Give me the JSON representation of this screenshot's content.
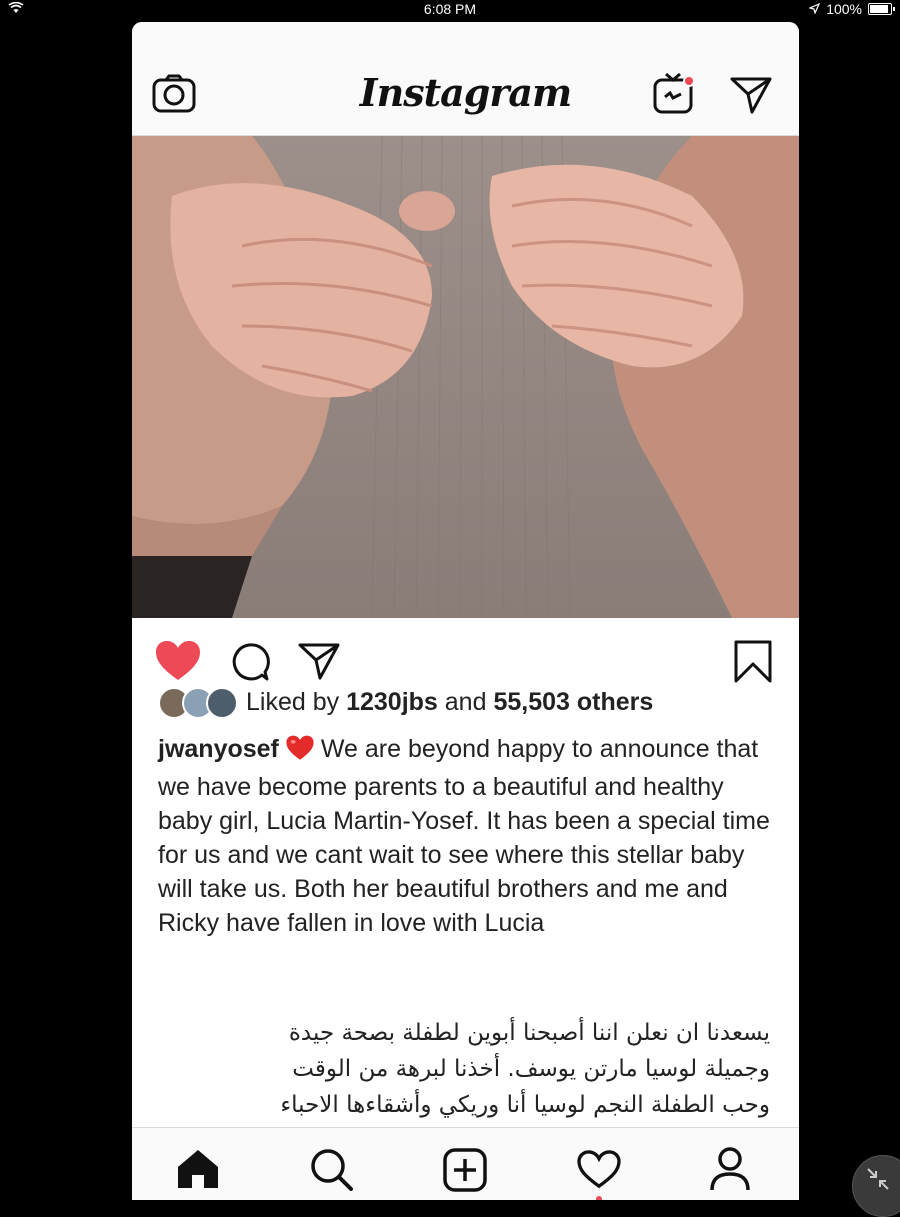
{
  "status_bar": {
    "time": "6:08 PM",
    "battery": "100%",
    "battery_level": 1.0
  },
  "app": {
    "title": "Instagram"
  },
  "top_icons": {
    "camera": "camera-icon",
    "igtv": "igtv-icon",
    "direct": "direct-message-icon"
  },
  "post": {
    "image": "newborn-hands-photo",
    "liked": {
      "prefix": "Liked by",
      "user": "1230jbs",
      "and": "and",
      "count": "55,503 others"
    },
    "caption": {
      "username": "jwanyosef",
      "emoji": "red-heart",
      "text": "We are beyond happy to announce that we have become parents to a beautiful and healthy baby girl, Lucia Martin-Yosef. It has been a special time for us and we cant wait to see where this stellar baby will take us. Both her beautiful brothers and me and Ricky have fallen in love with Lucia"
    },
    "arabic_lines": [
      "يسعدنا ان نعلن اننا أصبحنا أبوين لطفلة بصحة جيدة",
      "وجميلة لوسيا مارتن يوسف. أخذنا لبرهة من الوقت",
      "وحب الطفلة النجم لوسيا أنا وريكي وأشقاءها الاحباء"
    ]
  },
  "colors": {
    "like_red": "#ed4956",
    "text": "#262626",
    "divider": "#dbdbdb"
  },
  "tabs": [
    "home-icon",
    "search-icon",
    "add-post-icon",
    "activity-heart-icon",
    "profile-icon"
  ]
}
